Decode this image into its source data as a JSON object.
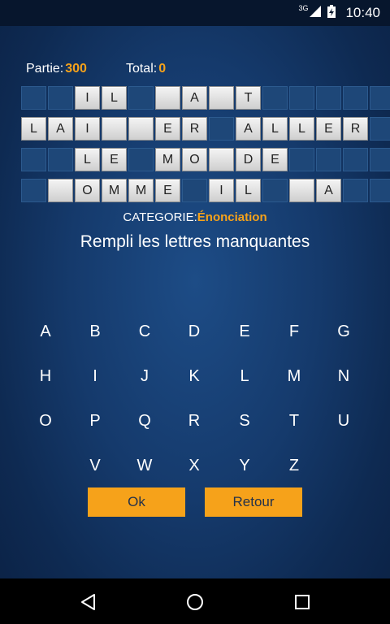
{
  "status_bar": {
    "network": "3G",
    "time": "10:40"
  },
  "scores": {
    "partie_label": "Partie:",
    "partie_value": "300",
    "total_label": "Total:",
    "total_value": "0"
  },
  "board": {
    "rows": [
      [
        "",
        "",
        "I",
        "L",
        "",
        "",
        "A",
        "",
        "T",
        "",
        "",
        "",
        "",
        ""
      ],
      [
        "L",
        "A",
        "I",
        "",
        "",
        "E",
        "R",
        "",
        "A",
        "L",
        "L",
        "E",
        "R",
        ""
      ],
      [
        "",
        "",
        "L",
        "E",
        "",
        "M",
        "O",
        "",
        "D",
        "E",
        "",
        "",
        "",
        ""
      ],
      [
        "",
        "",
        "O",
        "M",
        "M",
        "E",
        "",
        "I",
        "L",
        "",
        "",
        "A",
        "",
        ""
      ]
    ],
    "tiles": [
      [
        0,
        0,
        1,
        1,
        0,
        1,
        1,
        1,
        1,
        0,
        0,
        0,
        0,
        0
      ],
      [
        1,
        1,
        1,
        1,
        1,
        1,
        1,
        0,
        1,
        1,
        1,
        1,
        1,
        0
      ],
      [
        0,
        0,
        1,
        1,
        0,
        1,
        1,
        1,
        1,
        1,
        0,
        0,
        0,
        0
      ],
      [
        0,
        1,
        1,
        1,
        1,
        1,
        0,
        1,
        1,
        0,
        1,
        1,
        0,
        0
      ]
    ]
  },
  "category": {
    "label": "CATEGORIE:",
    "value": "Énonciation"
  },
  "instruction": "Rempli les lettres manquantes",
  "keyboard": {
    "rows": [
      [
        "A",
        "B",
        "C",
        "D",
        "E",
        "F",
        "G"
      ],
      [
        "H",
        "I",
        "J",
        "K",
        "L",
        "M",
        "N"
      ],
      [
        "O",
        "P",
        "Q",
        "R",
        "S",
        "T",
        "U"
      ],
      [
        "V",
        "W",
        "X",
        "Y",
        "Z"
      ]
    ]
  },
  "buttons": {
    "ok": "Ok",
    "back": "Retour"
  },
  "colors": {
    "accent": "#f6a21a",
    "background": "#153a6c"
  }
}
